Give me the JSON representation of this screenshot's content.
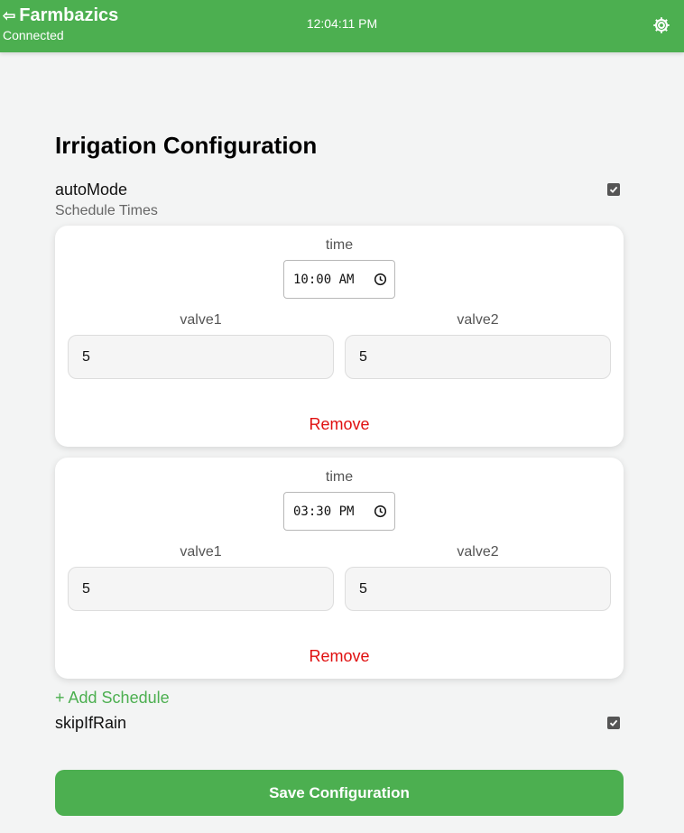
{
  "header": {
    "app_name": "Farmbazics",
    "status": "Connected",
    "time": "12:04:11 PM",
    "back_icon": "back-arrow-icon",
    "settings_icon": "gear-icon",
    "bg_color": "#4caf50"
  },
  "page": {
    "title": "Irrigation Configuration",
    "auto_mode": {
      "label": "autoMode",
      "checked": true
    },
    "schedule_label": "Schedule Times",
    "schedules": [
      {
        "time_label": "time",
        "time_value": "10:00 AM",
        "valve1_label": "valve1",
        "valve1_value": "5",
        "valve2_label": "valve2",
        "valve2_value": "5",
        "remove_label": "Remove"
      },
      {
        "time_label": "time",
        "time_value": "03:30 PM",
        "valve1_label": "valve1",
        "valve1_value": "5",
        "valve2_label": "valve2",
        "valve2_value": "5",
        "remove_label": "Remove"
      }
    ],
    "add_schedule_label": "+ Add Schedule",
    "skip_if_rain": {
      "label": "skipIfRain",
      "checked": true
    },
    "save_label": "Save Configuration",
    "accent_color": "#4caf50",
    "danger_color": "#e01010"
  }
}
